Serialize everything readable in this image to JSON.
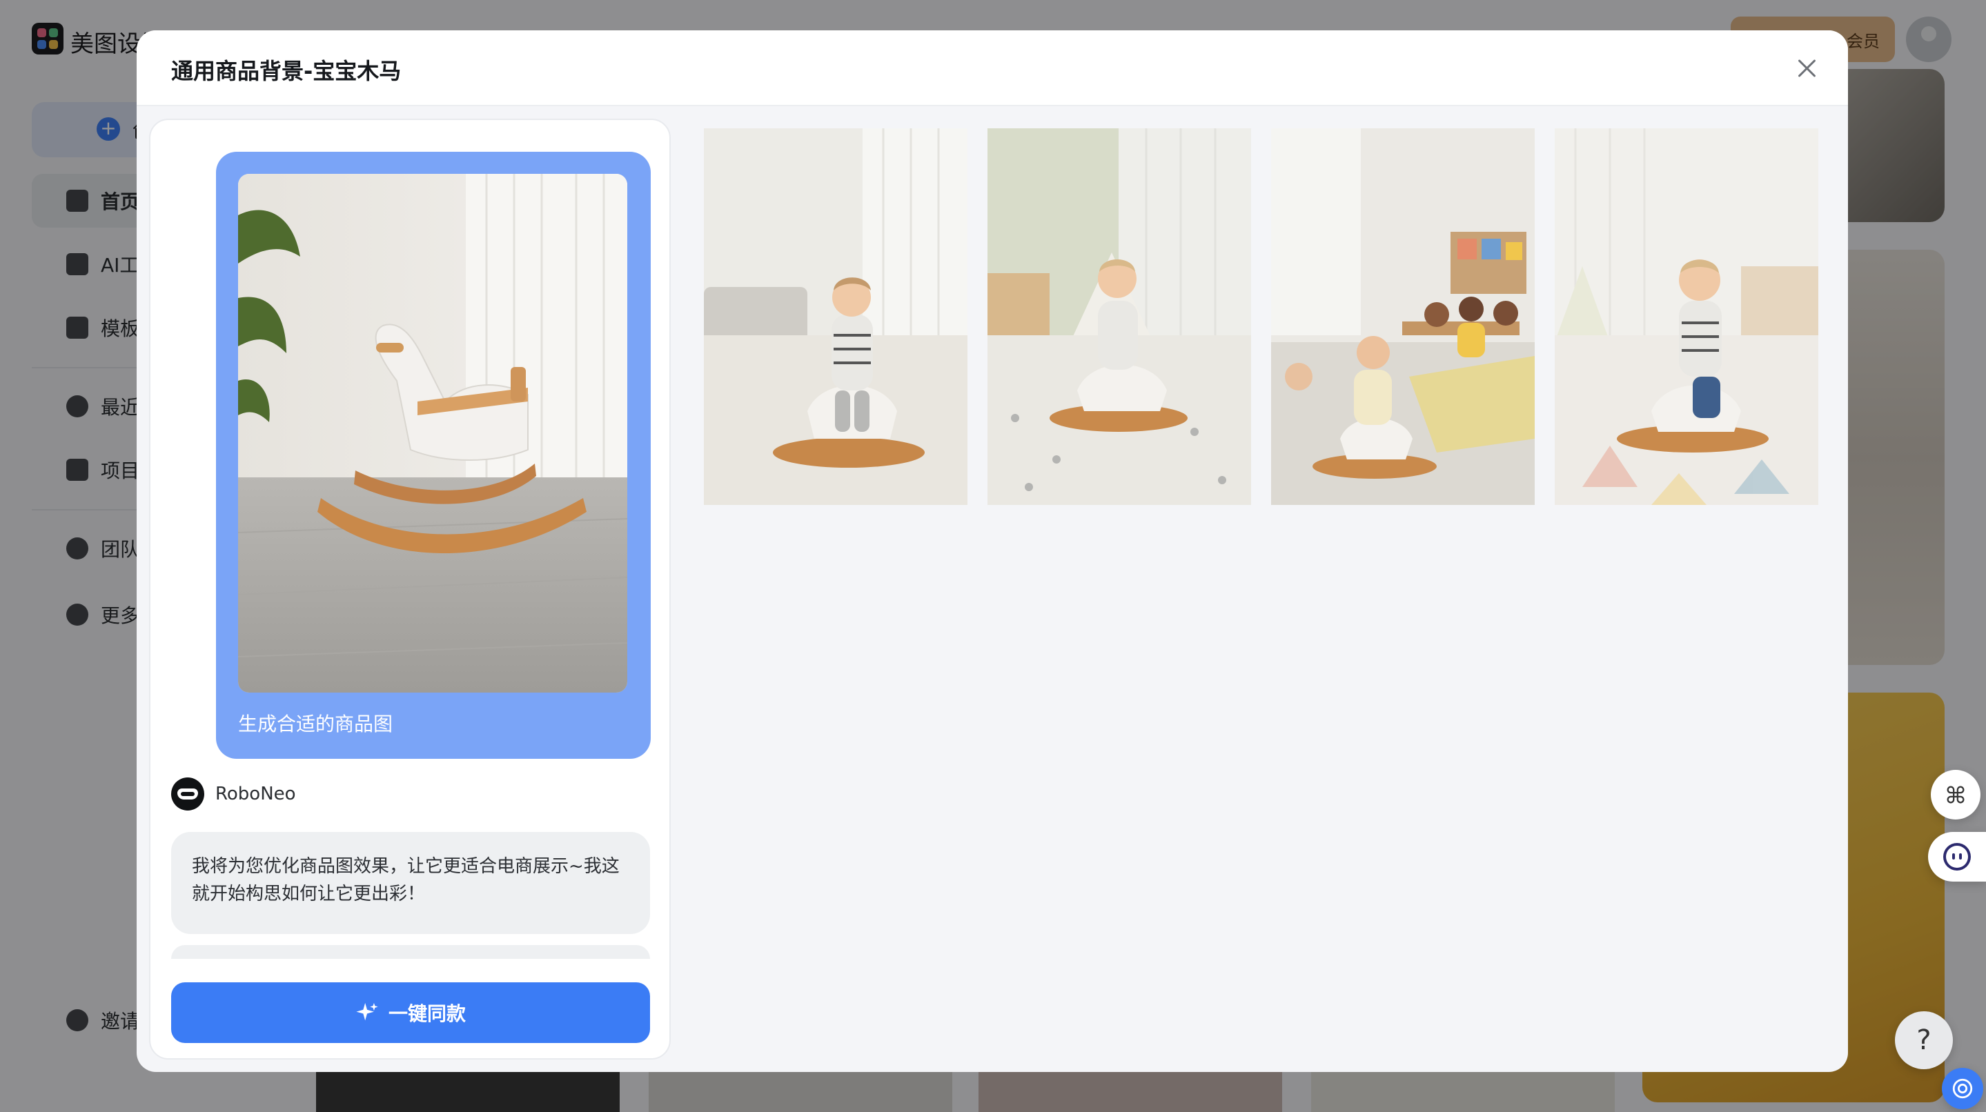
{
  "background": {
    "app_name": "美图设计室",
    "vip_label": "会员",
    "sidebar": {
      "create_label": "创建",
      "items": [
        {
          "label": "首页",
          "active": true,
          "icon": "home-icon"
        },
        {
          "label": "AI工",
          "icon": "cube-icon"
        },
        {
          "label": "模板",
          "icon": "template-icon"
        },
        {
          "label": "最近",
          "icon": "clock-icon"
        },
        {
          "label": "项目",
          "icon": "folder-icon"
        },
        {
          "label": "团队",
          "icon": "team-icon"
        },
        {
          "label": "更多",
          "icon": "more-icon"
        },
        {
          "label": "邀请",
          "icon": "invite-icon"
        }
      ]
    },
    "help_label": "?"
  },
  "modal": {
    "title": "通用商品背景-宝宝木马",
    "close_icon": "close-icon",
    "chat": {
      "user_caption": "生成合适的商品图",
      "bot_name": "RoboNeo",
      "bot_message": "我将为您优化商品图效果，让它更适合电商展示~我这就开始构思如何让它更出彩！",
      "cta_label": "一键同款",
      "cta_icon": "sparkle-icon"
    },
    "results": [
      {
        "alt": "living room toddler on rocking horse"
      },
      {
        "alt": "nursery teepee toddler on rocking horse"
      },
      {
        "alt": "playroom children with rocking horse"
      },
      {
        "alt": "bright nursery toddler on rocking horse"
      }
    ]
  },
  "colors": {
    "accent": "#3b7cf5",
    "user_bubble": "#7aa4f7",
    "modal_bg": "#f4f5f8"
  }
}
